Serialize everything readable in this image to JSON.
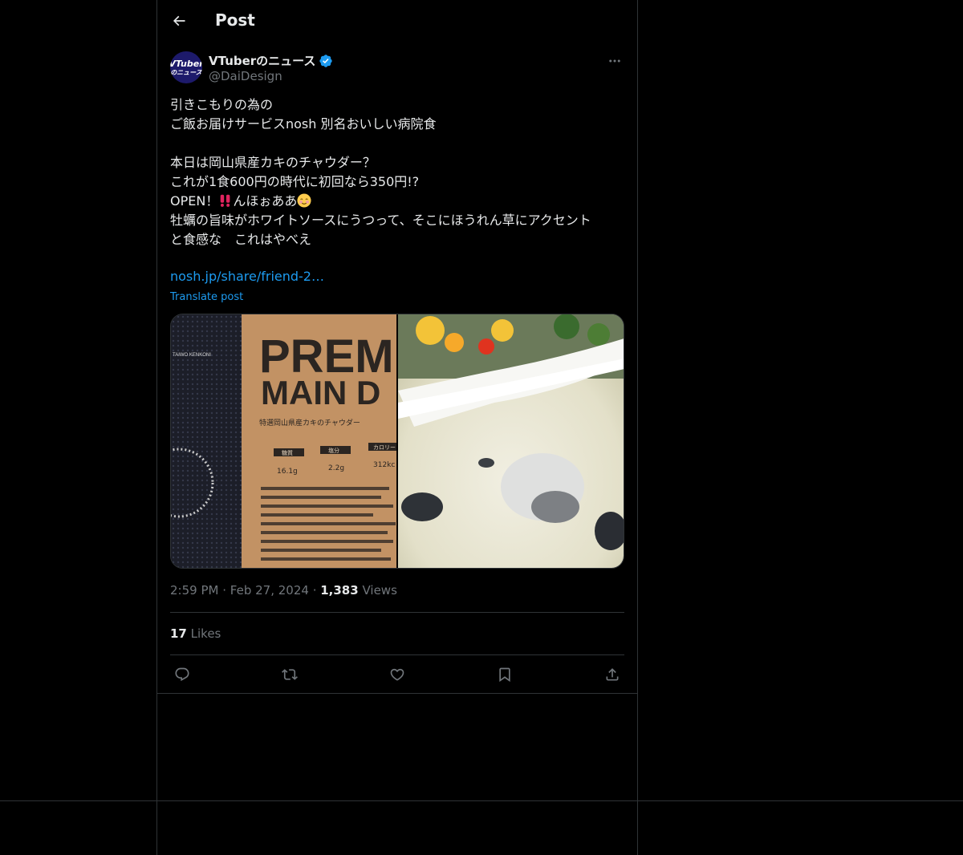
{
  "header": {
    "title": "Post",
    "back_icon": "arrow-left-icon"
  },
  "author": {
    "name": "VTuberのニュース",
    "handle": "@DaiDesign",
    "avatar_text_line1": "VTuber",
    "avatar_text_line2": "のニュース",
    "verified_color": "#1d9bf0"
  },
  "post": {
    "text_part1": "引きこもりの為の\nご飯お届けサービスnosh 別名おいしい病院食\n\n本日は岡山県産カキのチャウダー？\nこれが1食600円の時代に初回なら350円!?\nOPEN！",
    "text_part2": "んほぉああ",
    "text_part3": "\n牡蠣の旨味がホワイトソースにうつって、そこにほうれん草にアクセント\nと食感な　これはやべえ",
    "link": "nosh.jp/share/friend-2…",
    "translate": "Translate post"
  },
  "media": {
    "left_package_title_1": "PREM",
    "left_package_title_2": "MAIN D",
    "left_package_subtitle": "特選岡山県産カキのチャウダー",
    "left_brand": "TAIWO KENKONI",
    "left_nutrition_labels": [
      "糖質",
      "塩分",
      "カロリー"
    ],
    "left_nutrition_values": [
      "16.1g",
      "2.2g",
      "312kc"
    ]
  },
  "meta": {
    "time": "2:59 PM",
    "date": "Feb 27, 2024",
    "views_count": "1,383",
    "views_label": "Views",
    "likes_count": "17",
    "likes_label": "Likes"
  },
  "actions": [
    {
      "name": "reply",
      "icon": "reply-icon"
    },
    {
      "name": "repost",
      "icon": "repost-icon"
    },
    {
      "name": "like",
      "icon": "heart-icon"
    },
    {
      "name": "bookmark",
      "icon": "bookmark-icon"
    },
    {
      "name": "share",
      "icon": "share-icon"
    }
  ],
  "colors": {
    "background": "#000000",
    "text": "#e7e9ea",
    "muted": "#71767b",
    "accent": "#1d9bf0",
    "border": "#2f3336"
  }
}
